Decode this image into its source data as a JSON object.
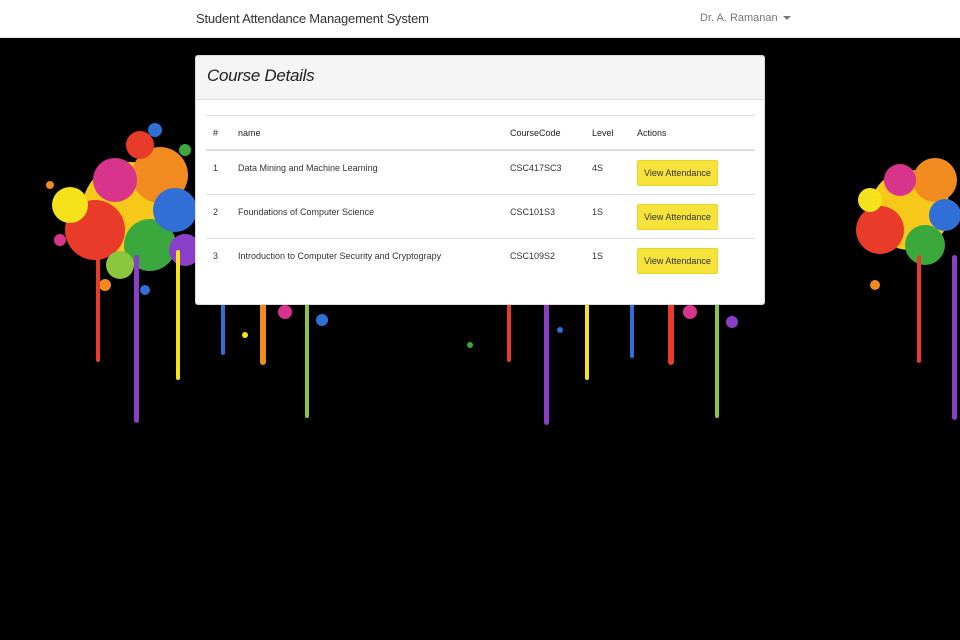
{
  "navbar": {
    "brand": "Student Attendance Management System",
    "user": "Dr. A. Ramanan"
  },
  "panel": {
    "title": "Course Details"
  },
  "table": {
    "headers": {
      "num": "#",
      "name": "name",
      "code": "CourseCode",
      "level": "Level",
      "actions": "Actions"
    },
    "rows": [
      {
        "num": "1",
        "name": "Data Mining and Machine Learning",
        "code": "CSC417SC3",
        "level": "4S",
        "action": "View Attendance"
      },
      {
        "num": "2",
        "name": "Foundations of Computer Science",
        "code": "CSC101S3",
        "level": "1S",
        "action": "View Attendance"
      },
      {
        "num": "3",
        "name": "Introduction to Computer Security and Cryptograpy",
        "code": "CSC109S2",
        "level": "1S",
        "action": "View Attendance"
      }
    ]
  },
  "colors": {
    "background": "#000000",
    "button": "#f5e33b",
    "navbar": "#ffffff"
  },
  "background_image": "paint-splatter-decoration"
}
